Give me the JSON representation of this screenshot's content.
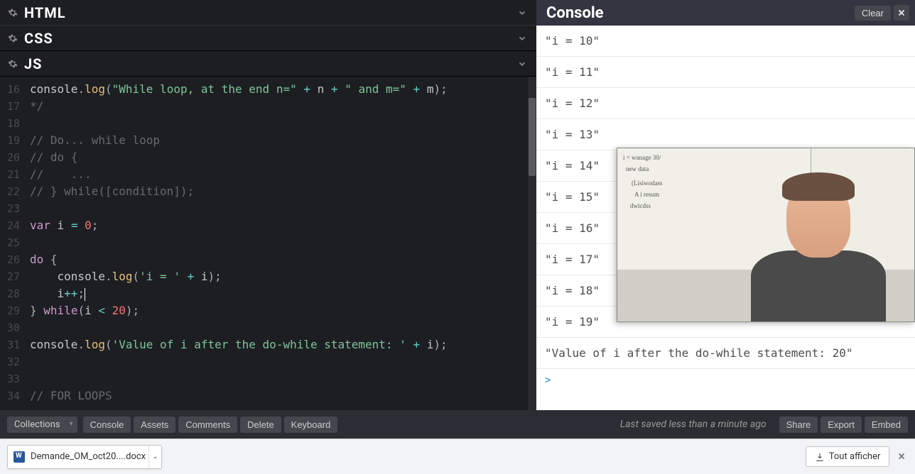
{
  "panels": {
    "html_label": "HTML",
    "css_label": "CSS",
    "js_label": "JS"
  },
  "editor": {
    "first_line_number": 16,
    "lines": [
      {
        "n": 16,
        "html": "<span class='ident'>console</span><span class='punc'>.</span><span class='fn'>log</span><span class='punc'>(</span><span class='str'>\"While loop, at the end n=\"</span> <span class='op'>+</span> <span class='ident'>n</span> <span class='op'>+</span> <span class='str'>\" and m=\"</span> <span class='op'>+</span> <span class='ident'>m</span><span class='punc'>);</span>"
      },
      {
        "n": 17,
        "html": "<span class='com'>*/</span>"
      },
      {
        "n": 18,
        "html": ""
      },
      {
        "n": 19,
        "html": "<span class='com'>// Do... while loop</span>"
      },
      {
        "n": 20,
        "html": "<span class='com'>// do {</span>"
      },
      {
        "n": 21,
        "html": "<span class='com'>//    ...</span>"
      },
      {
        "n": 22,
        "html": "<span class='com'>// } while([condition]);</span>"
      },
      {
        "n": 23,
        "html": ""
      },
      {
        "n": 24,
        "html": "<span class='kw'>var</span> <span class='ident'>i</span> <span class='op'>=</span> <span class='num'>0</span><span class='punc'>;</span>"
      },
      {
        "n": 25,
        "html": ""
      },
      {
        "n": 26,
        "html": "<span class='kw'>do</span> <span class='punc'>{</span>"
      },
      {
        "n": 27,
        "html": "    <span class='ident'>console</span><span class='punc'>.</span><span class='fn'>log</span><span class='punc'>(</span><span class='str'>'i = '</span> <span class='op'>+</span> <span class='ident'>i</span><span class='punc'>);</span>"
      },
      {
        "n": 28,
        "html": "    <span class='ident'>i</span><span class='op'>++</span><span class='punc'>;</span><span class='caret'></span>"
      },
      {
        "n": 29,
        "html": "<span class='punc'>}</span> <span class='kw'>while</span><span class='punc'>(</span><span class='ident'>i</span> <span class='op'>&lt;</span> <span class='num'>20</span><span class='punc'>);</span>"
      },
      {
        "n": 30,
        "html": ""
      },
      {
        "n": 31,
        "html": "<span class='ident'>console</span><span class='punc'>.</span><span class='fn'>log</span><span class='punc'>(</span><span class='str'>'Value of i after the do-while statement: '</span> <span class='op'>+</span> <span class='ident'>i</span><span class='punc'>);</span>"
      },
      {
        "n": 32,
        "html": ""
      },
      {
        "n": 33,
        "html": ""
      },
      {
        "n": 34,
        "html": "<span class='com'>// FOR LOOPS</span>"
      }
    ]
  },
  "console": {
    "title": "Console",
    "clear_label": "Clear",
    "lines": [
      "\"i = 10\"",
      "\"i = 11\"",
      "\"i = 12\"",
      "\"i = 13\"",
      "\"i = 14\"",
      "\"i = 15\"",
      "\"i = 16\"",
      "\"i = 17\"",
      "\"i = 18\"",
      "\"i = 19\"",
      "\"Value of i after the do-while statement: 20\""
    ],
    "prompt": ">"
  },
  "footer": {
    "dropdown": "Collections",
    "buttons": [
      "Console",
      "Assets",
      "Comments",
      "Delete",
      "Keyboard"
    ],
    "status": "Last saved less than a minute ago",
    "right_buttons": [
      "Share",
      "Export",
      "Embed"
    ]
  },
  "download": {
    "filename": "Demande_OM_oct20....docx",
    "show_all": "Tout afficher"
  }
}
